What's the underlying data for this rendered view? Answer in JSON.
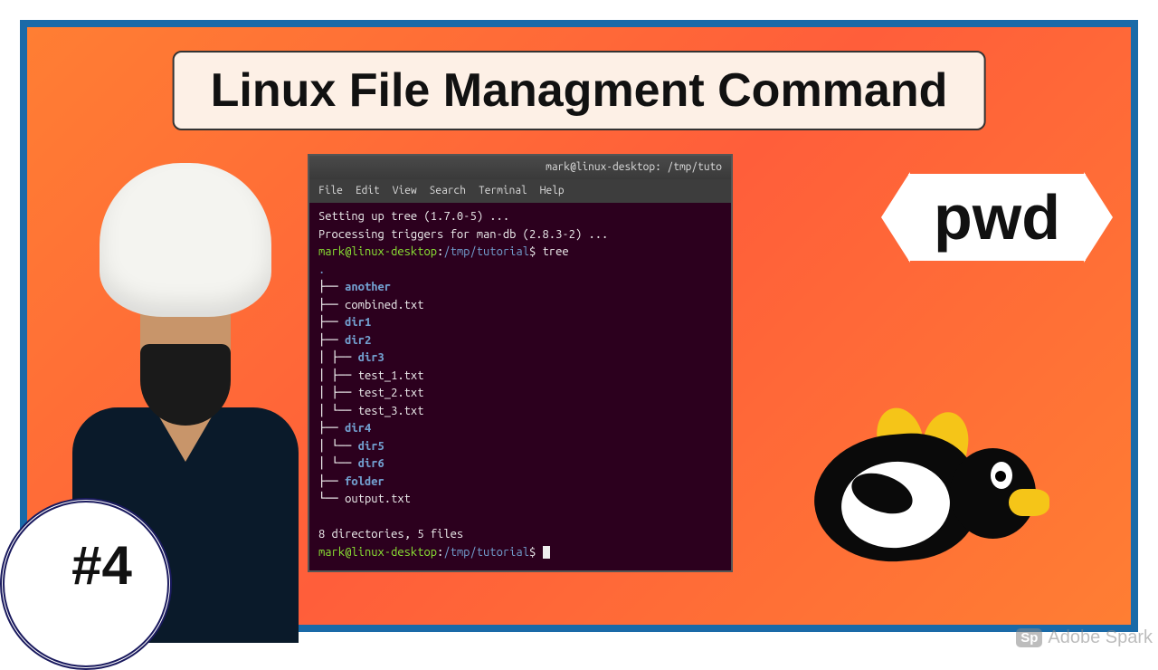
{
  "title": "Linux File Managment Command",
  "command_badge": "pwd",
  "episode": "#4",
  "watermark": {
    "logo": "Sp",
    "text": "Adobe Spark"
  },
  "terminal": {
    "window_title": "mark@linux-desktop: /tmp/tuto",
    "menu": [
      "File",
      "Edit",
      "View",
      "Search",
      "Terminal",
      "Help"
    ],
    "line1": "Setting up tree (1.7.0-5) ...",
    "line2": "Processing triggers for man-db (2.8.3-2) ...",
    "prompt_user": "mark@linux-desktop",
    "prompt_path": "/tmp/tutorial",
    "prompt_dollar": "$",
    "command": "tree",
    "tree": {
      "root": ".",
      "lines": [
        {
          "prefix": "├── ",
          "name": "another",
          "dir": true
        },
        {
          "prefix": "├── ",
          "name": "combined.txt",
          "dir": false
        },
        {
          "prefix": "├── ",
          "name": "dir1",
          "dir": true
        },
        {
          "prefix": "├── ",
          "name": "dir2",
          "dir": true
        },
        {
          "prefix": "│   ├── ",
          "name": "dir3",
          "dir": true
        },
        {
          "prefix": "│   ├── ",
          "name": "test_1.txt",
          "dir": false
        },
        {
          "prefix": "│   ├── ",
          "name": "test_2.txt",
          "dir": false
        },
        {
          "prefix": "│   └── ",
          "name": "test_3.txt",
          "dir": false
        },
        {
          "prefix": "├── ",
          "name": "dir4",
          "dir": true
        },
        {
          "prefix": "│   └── ",
          "name": "dir5",
          "dir": true
        },
        {
          "prefix": "│       └── ",
          "name": "dir6",
          "dir": true
        },
        {
          "prefix": "├── ",
          "name": "folder",
          "dir": true
        },
        {
          "prefix": "└── ",
          "name": "output.txt",
          "dir": false
        }
      ]
    },
    "summary": "8 directories, 5 files"
  }
}
